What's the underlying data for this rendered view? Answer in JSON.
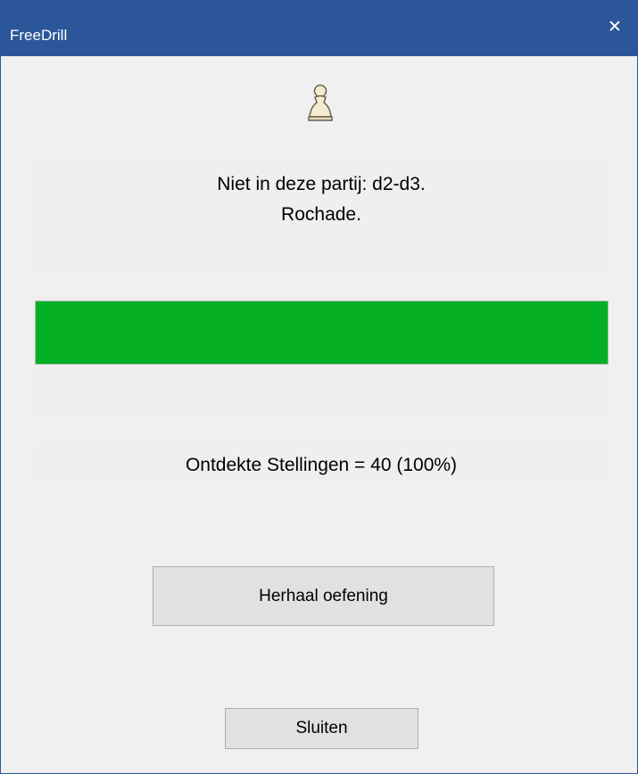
{
  "window": {
    "title": "FreeDrill",
    "close_glyph": "✕",
    "accent_color": "#2b579a"
  },
  "icon": {
    "name": "white-pawn-icon"
  },
  "message": {
    "line1": "Niet in deze partij: d2-d3.",
    "line2": "Rochade."
  },
  "progress": {
    "percent": 100,
    "fill_color": "#06b025"
  },
  "stats": {
    "text": "Ontdekte Stellingen = 40 (100%)"
  },
  "buttons": {
    "repeat_label": "Herhaal oefening",
    "close_label": "Sluiten"
  }
}
